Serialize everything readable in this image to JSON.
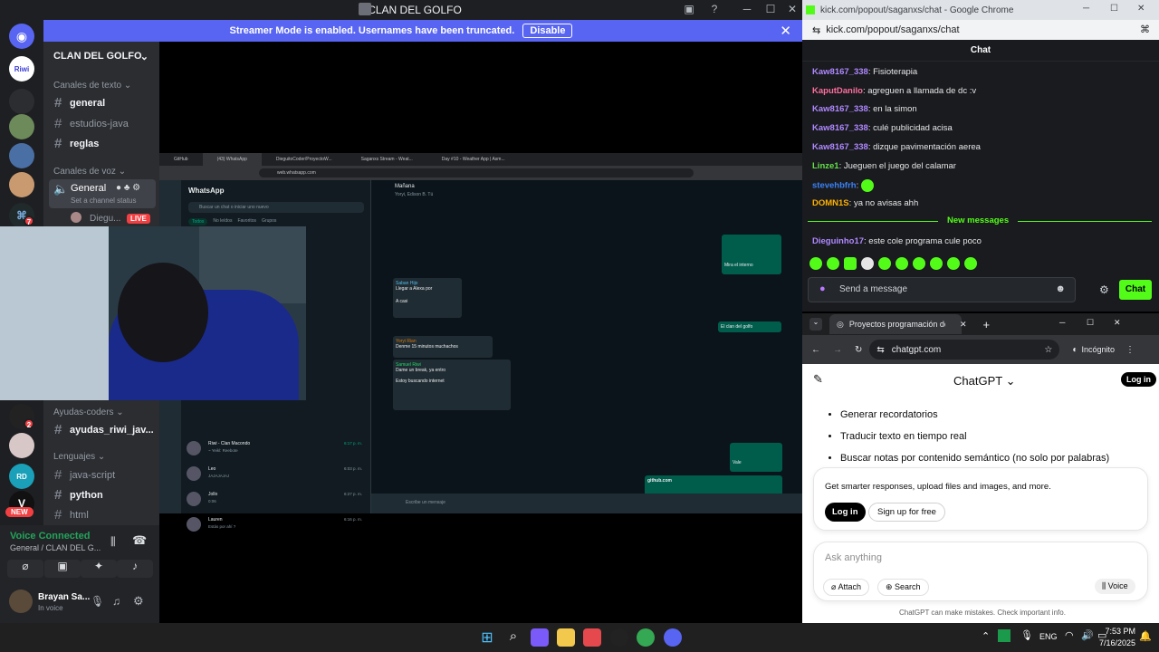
{
  "discord": {
    "window_title": "CLAN DEL GOLFO",
    "banner_text": "Streamer Mode is enabled. Usernames have been truncated.",
    "banner_button": "Disable",
    "server_name": "CLAN DEL GOLFO",
    "cat_text": "Canales de texto",
    "text_channels": [
      "general",
      "estudios-java",
      "reglas"
    ],
    "cat_voice": "Canales de voz",
    "voice_channel": "General",
    "voice_status": "Set a channel status",
    "voice_user": "Diegu...",
    "live": "LIVE",
    "cat_ayudas": "Ayudas-coders",
    "ayudas_channel": "ayudas_riwi_jav...",
    "cat_lenguajes": "Lenguajes",
    "lang_channels": [
      "java-script",
      "python",
      "html"
    ],
    "new_badge": "NEW",
    "voice_connected": "Voice Connected",
    "voice_location": "General / CLAN DEL G...",
    "user_name": "Brayan Sa...",
    "user_status": "In voice",
    "server_badges": [
      "2",
      "7"
    ]
  },
  "stream": {
    "tabs": [
      "GitHub",
      "(43) WhatsApp",
      "DieguitoCoder/ProyectoW...",
      "Saganxs Stream - Weat...",
      "Day #10 - Weather App | Asm..."
    ],
    "url": "web.whatsapp.com",
    "wa_title": "WhatsApp",
    "wa_search": "Buscar un chat o iniciar uno nuevo",
    "wa_filters": [
      "Todos",
      "No leídos",
      "Favoritos",
      "Grupos"
    ],
    "chat_name": "Mañana",
    "chat_members": "Yoryi, Edison B. Tú",
    "chats": [
      {
        "name": "Riwi - Clan Macondo",
        "preview": "~ Yeikl: Reebote",
        "time": "6:17 p. m."
      },
      {
        "name": "Leo",
        "preview": "JAJAJAJAJ",
        "time": "6:03 p. m."
      },
      {
        "name": "Jollo",
        "preview": "0:06",
        "time": "6:27 p. m."
      },
      {
        "name": "Lauren",
        "preview": "Estás por ahí ?",
        "time": "6:16 p. m."
      }
    ],
    "messages": [
      {
        "sender": "Saban Hijo",
        "text": "Llegar a Alexa por",
        "time": "7:53 p. m."
      },
      {
        "sender": "",
        "text": "A casi",
        "time": "7:53 p. m."
      },
      {
        "sender": "Yoryi Rian",
        "text": "Denme 15 minutos muchachos",
        "time": "7:53 p. m."
      },
      {
        "sender": "Samuel Riwi",
        "text": "Dame un break, ya entro",
        "time": "7:53 p. m."
      },
      {
        "sender": "",
        "text": "Estoy buscando internet",
        "time": "7:53 p. m."
      }
    ],
    "out_messages": [
      "Mira el interno",
      "El clan del golfo",
      "Vale",
      "github.com"
    ],
    "compose_placeholder": "Escribe un mensaje"
  },
  "kick": {
    "window_title": "kick.com/popout/saganxs/chat - Google Chrome",
    "url": "kick.com/popout/saganxs/chat",
    "header": "Chat",
    "messages": [
      {
        "user": "Kaw8167_338",
        "text": "Fisioterapia",
        "color": "#b088ff"
      },
      {
        "user": "KaputDanilo",
        "text": "agreguen a llamada de dc :v",
        "color": "#ff6f9e"
      },
      {
        "user": "Kaw8167_338",
        "text": "en la simon",
        "color": "#b088ff"
      },
      {
        "user": "Kaw8167_338",
        "text": "culé publicidad acisa",
        "color": "#b088ff"
      },
      {
        "user": "Kaw8167_338",
        "text": "dizque pavimentación aerea",
        "color": "#b088ff"
      },
      {
        "user": "Linze1",
        "text": "Jueguen el juego del calamar",
        "color": "#66e04a"
      },
      {
        "user": "stevehbfrh",
        "text": "",
        "color": "#3b82f6"
      },
      {
        "user": "DOMN1S",
        "text": "ya no avisas ahh",
        "color": "#ffb000"
      }
    ],
    "new_messages": "New messages",
    "latest": {
      "user": "Dieguinho17",
      "text": "este cole programa cule poco",
      "color": "#b088ff"
    },
    "input_placeholder": "Send a message",
    "send_label": "Chat",
    "accent": "#53fc18"
  },
  "chatgpt": {
    "tab_title": "Proyectos programación desta...",
    "url": "chatgpt.com",
    "incognito": "Incógnito",
    "title": "ChatGPT",
    "login": "Log in",
    "bullets": [
      "Generar recordatorios",
      "Traducir texto en tiempo real",
      "Buscar notas por contenido semántico (no solo por palabras)"
    ],
    "promo": "Get smarter responses, upload files and images, and more.",
    "promo_login": "Log in",
    "signup": "Sign up for free",
    "input_placeholder": "Ask anything",
    "attach": "Attach",
    "search": "Search",
    "voice": "Voice",
    "disclaimer": "ChatGPT can make mistakes. Check important info."
  },
  "taskbar": {
    "lang": "ENG",
    "time": "7:53 PM",
    "date": "7/16/2025"
  }
}
